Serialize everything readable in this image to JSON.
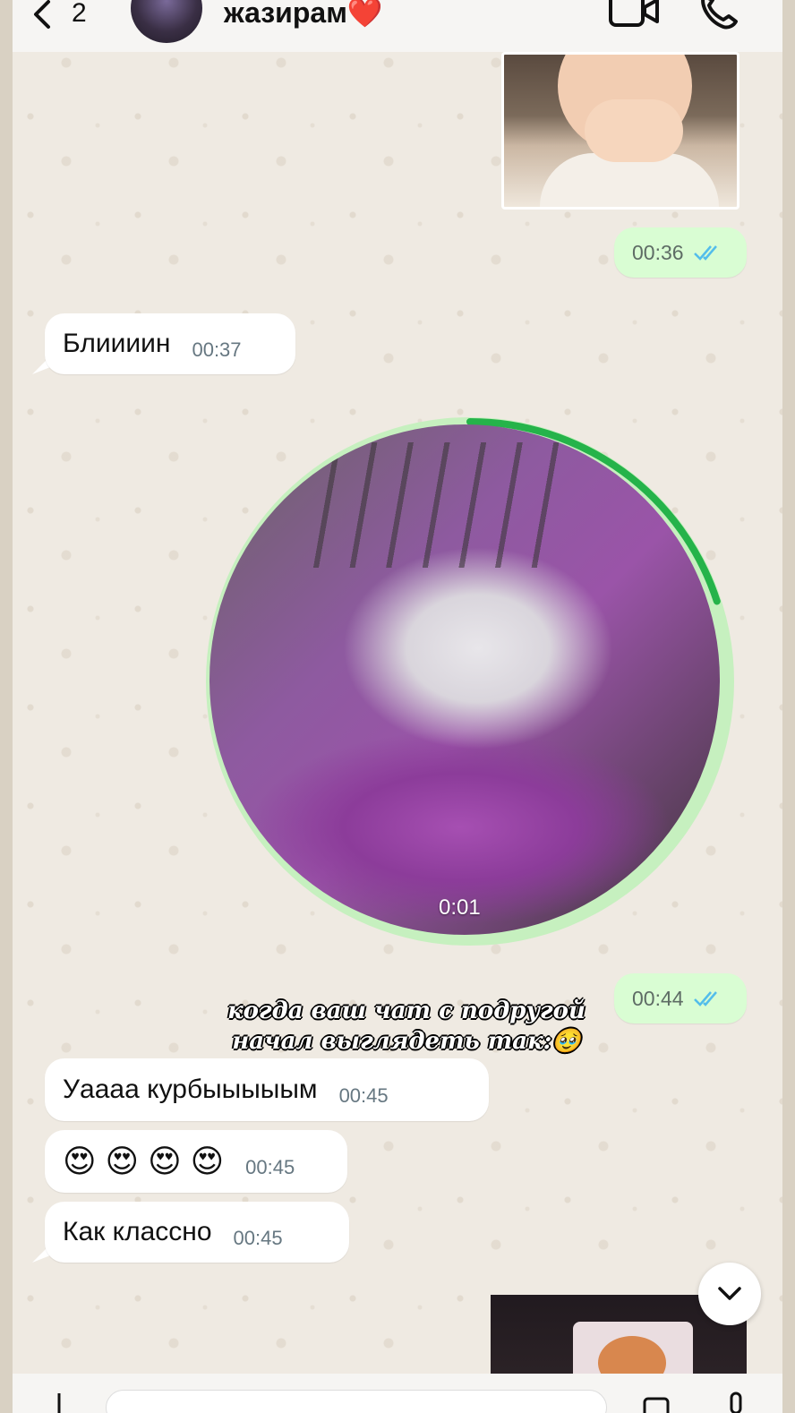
{
  "header": {
    "back_count": "2",
    "contact_name": "жазирам",
    "contact_emoji": "❤️",
    "icons": {
      "back": "chevron-left-icon",
      "video_call": "video-camera-icon",
      "voice_call": "phone-icon"
    }
  },
  "messages": {
    "sticker_time": "00:36",
    "blin": {
      "text": "Блиииин",
      "time": "00:37"
    },
    "video_note": {
      "duration": "0:01",
      "time": "00:44",
      "progress_fraction": 0.2
    },
    "uaaa": {
      "text": "Уаааа курбыыыыым",
      "time": "00:45"
    },
    "emoji": {
      "text": "😍 😍 😍 😍",
      "time": "00:45"
    },
    "klassno": {
      "text": "Как классно",
      "time": "00:45"
    }
  },
  "overlay": {
    "line1": "когда ваш чат с подругой",
    "line2": "начал выглядеть так:🥹"
  },
  "colors": {
    "outgoing_bubble": "#d9fdd3",
    "incoming_bubble": "#ffffff",
    "read_ticks": "#53bdeb",
    "video_progress": "#25b34a",
    "heart": "#e0192e"
  }
}
